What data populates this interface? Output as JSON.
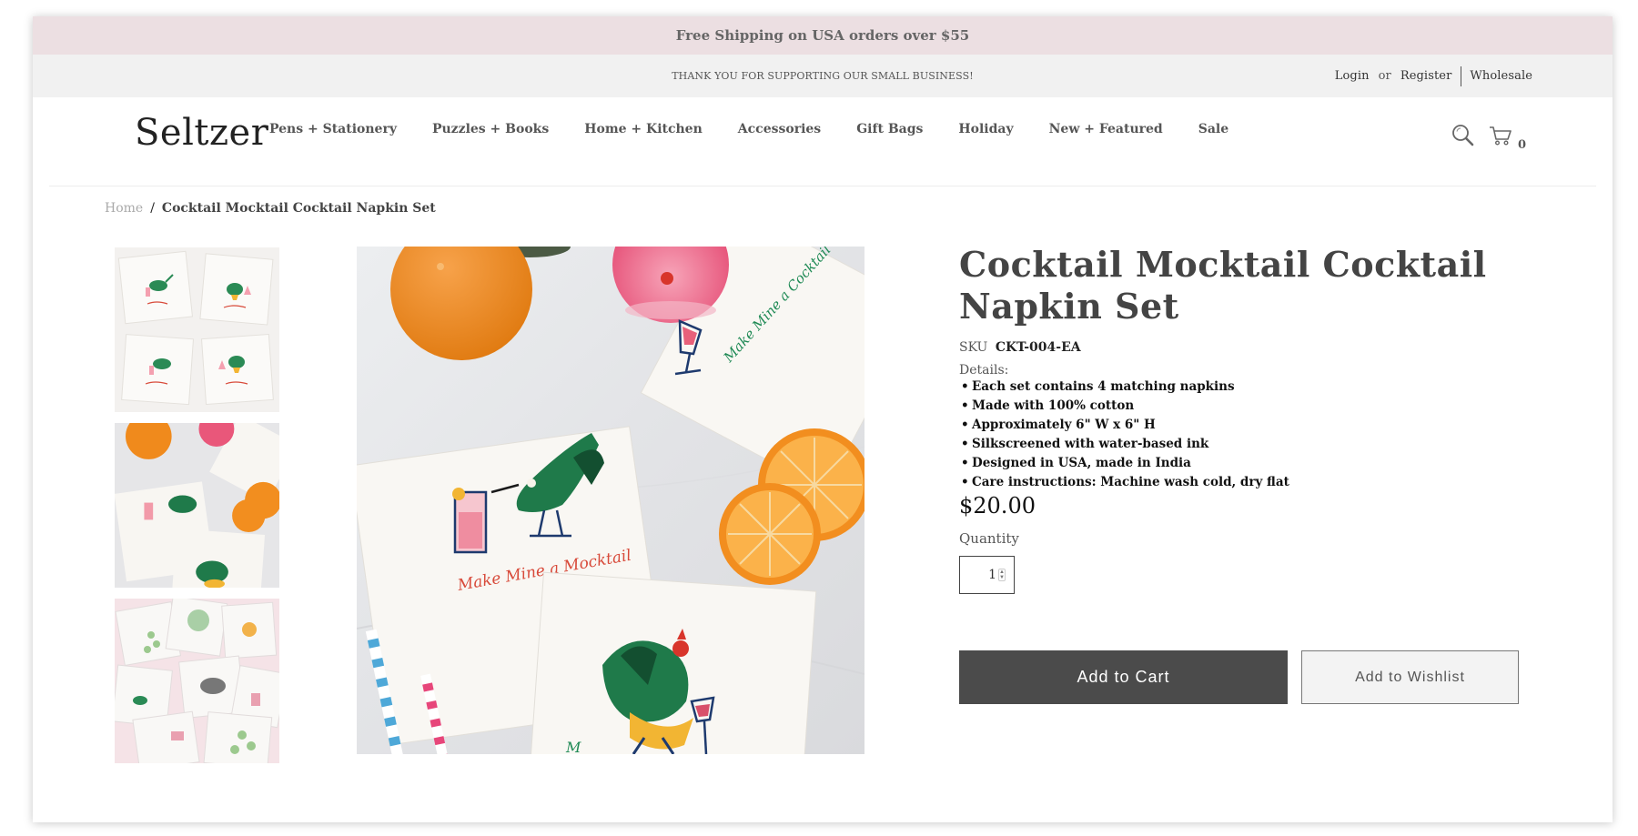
{
  "promo": {
    "text": "Free Shipping on USA orders over $55"
  },
  "utility": {
    "message": "THANK YOU FOR SUPPORTING OUR SMALL BUSINESS!",
    "login": "Login",
    "or": "or",
    "register": "Register",
    "wholesale": "Wholesale"
  },
  "header": {
    "logo": "Seltzer",
    "nav": [
      {
        "label": "Pens + Stationery"
      },
      {
        "label": "Puzzles + Books"
      },
      {
        "label": "Home + Kitchen"
      },
      {
        "label": "Accessories"
      },
      {
        "label": "Gift Bags"
      },
      {
        "label": "Holiday"
      },
      {
        "label": "New + Featured"
      },
      {
        "label": "Sale"
      }
    ],
    "icons": {
      "search": "search-icon",
      "cart": "cart-icon"
    },
    "cart_count": "0"
  },
  "breadcrumb": {
    "home": "Home",
    "separator": "/",
    "current": "Cocktail Mocktail Cocktail Napkin Set"
  },
  "product": {
    "title": "Cocktail Mocktail Cocktail Napkin Set",
    "sku_label": "SKU",
    "sku": "CKT-004-EA",
    "details_label": "Details:",
    "details": [
      "Each set contains 4 matching napkins",
      "Made with 100% cotton",
      "Approximately 6\" W x 6\" H",
      "Silkscreened with water-based ink",
      "Designed in USA, made in India",
      "Care instructions: Machine wash cold, dry flat"
    ],
    "price": "$20.00",
    "quantity_label": "Quantity",
    "quantity": "1",
    "add_to_cart": "Add to Cart",
    "add_to_wishlist": "Add to Wishlist",
    "napkin_text": "Make Mine a Mocktail",
    "napkin_text_alt": "Make Mine a Cocktail"
  },
  "colors": {
    "promo_bg": "#ecdfe2",
    "utility_bg": "#f1f1f1",
    "button_dark": "#4b4b4b",
    "bird_green": "#1f7a4a",
    "orange": "#f08a1c",
    "script_red": "#d84a3a"
  }
}
